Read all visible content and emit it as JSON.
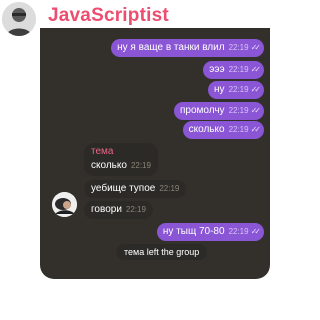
{
  "header": {
    "title": "JavaScriptist",
    "avatar_icon": "user-avatar-icon"
  },
  "messages": [
    {
      "text": "ну я ваще в танки влил",
      "time": "22:19",
      "ticks": "✓✓"
    },
    {
      "text": "эээ",
      "time": "22:19",
      "ticks": "✓✓"
    },
    {
      "text": "ну",
      "time": "22:19",
      "ticks": "✓✓"
    },
    {
      "text": "промолчу",
      "time": "22:19",
      "ticks": "✓✓"
    },
    {
      "text": "сколько",
      "time": "22:19",
      "ticks": "✓✓"
    },
    {
      "sender": "тема",
      "text": "сколько",
      "time": "22:19"
    },
    {
      "text": "уебище тупое",
      "time": "22:19"
    },
    {
      "text": "говори",
      "time": "22:19"
    },
    {
      "text": "ну тыщ 70-80",
      "time": "22:19",
      "ticks": "✓✓"
    }
  ],
  "service": {
    "text": "тема left the group"
  },
  "colors": {
    "title": "#ed4d6e",
    "outgoing_bubble": "#8a56d6",
    "incoming_bubble": "#2b2a26",
    "chat_background": "#33302c",
    "sender_name": "#e96585"
  }
}
